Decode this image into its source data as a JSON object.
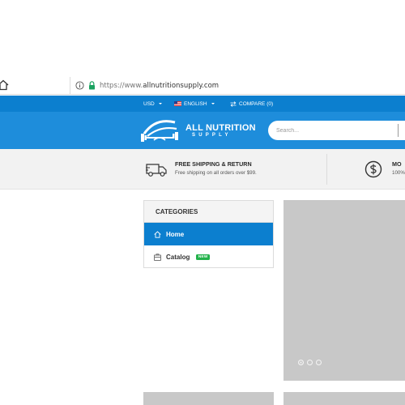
{
  "browser": {
    "url_scheme": "https://www.",
    "url_host": "allnutritionsupply.com"
  },
  "top_bar": {
    "currency": "USD",
    "language": "ENGLISH",
    "compare": "COMPARE (0)"
  },
  "header": {
    "logo_title": "ALL NUTRITION",
    "logo_subtitle": "SUPPLY",
    "search_placeholder": "Search..."
  },
  "info_strip": {
    "shipping_title": "FREE SHIPPING & RETURN",
    "shipping_desc": "Free shipping on all orders over $99.",
    "money_title": "MO",
    "money_desc": "100%"
  },
  "categories": {
    "heading": "CATEGORIES",
    "items": [
      {
        "label": "Home",
        "active": true
      },
      {
        "label": "Catalog",
        "badge": "NEW"
      }
    ]
  },
  "carousel": {
    "slide_count": 3,
    "active_index": 0
  },
  "colors": {
    "top_bar": "#0c7fcf",
    "header": "#1e8ddb",
    "new_badge": "#23b24b",
    "placeholder": "#c8c8c8"
  }
}
